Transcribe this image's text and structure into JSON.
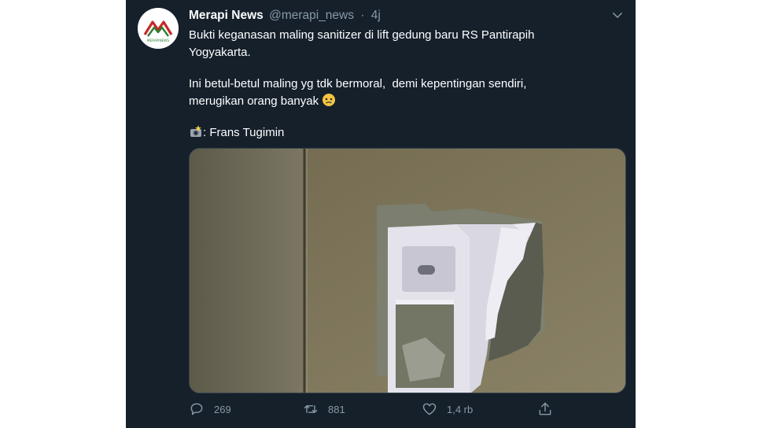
{
  "tweet": {
    "author": {
      "name": "Merapi News",
      "handle": "@merapi_news",
      "logo_text": "MERAPINEWS"
    },
    "separator": "·",
    "time": "4j",
    "text": {
      "paragraph1": "Bukti keganasan maling sanitizer di lift gedung baru RS Pantirapih\nYogyakarta.",
      "paragraph2": "Ini betul-betul maling yg tdk bermoral,  demi kepentingan sendiri,\nmerugikan orang banyak",
      "paragraph2_emoji": "sad-face-emoji",
      "credit_emoji": "camera-flash-emoji",
      "credit": ": Frans Tugimin"
    },
    "media": {
      "description_icon": "photo-of-broken-sanitizer-holder"
    },
    "actions": {
      "replies": "269",
      "retweets": "881",
      "likes": "1,4 rb"
    },
    "icons": {
      "reply": "reply-icon",
      "retweet": "retweet-icon",
      "like": "heart-icon",
      "share": "share-icon",
      "more": "chevron-down-icon"
    }
  },
  "colors": {
    "background": "#15202b",
    "text": "#ffffff",
    "muted": "#8899a6",
    "border": "#38444d"
  }
}
